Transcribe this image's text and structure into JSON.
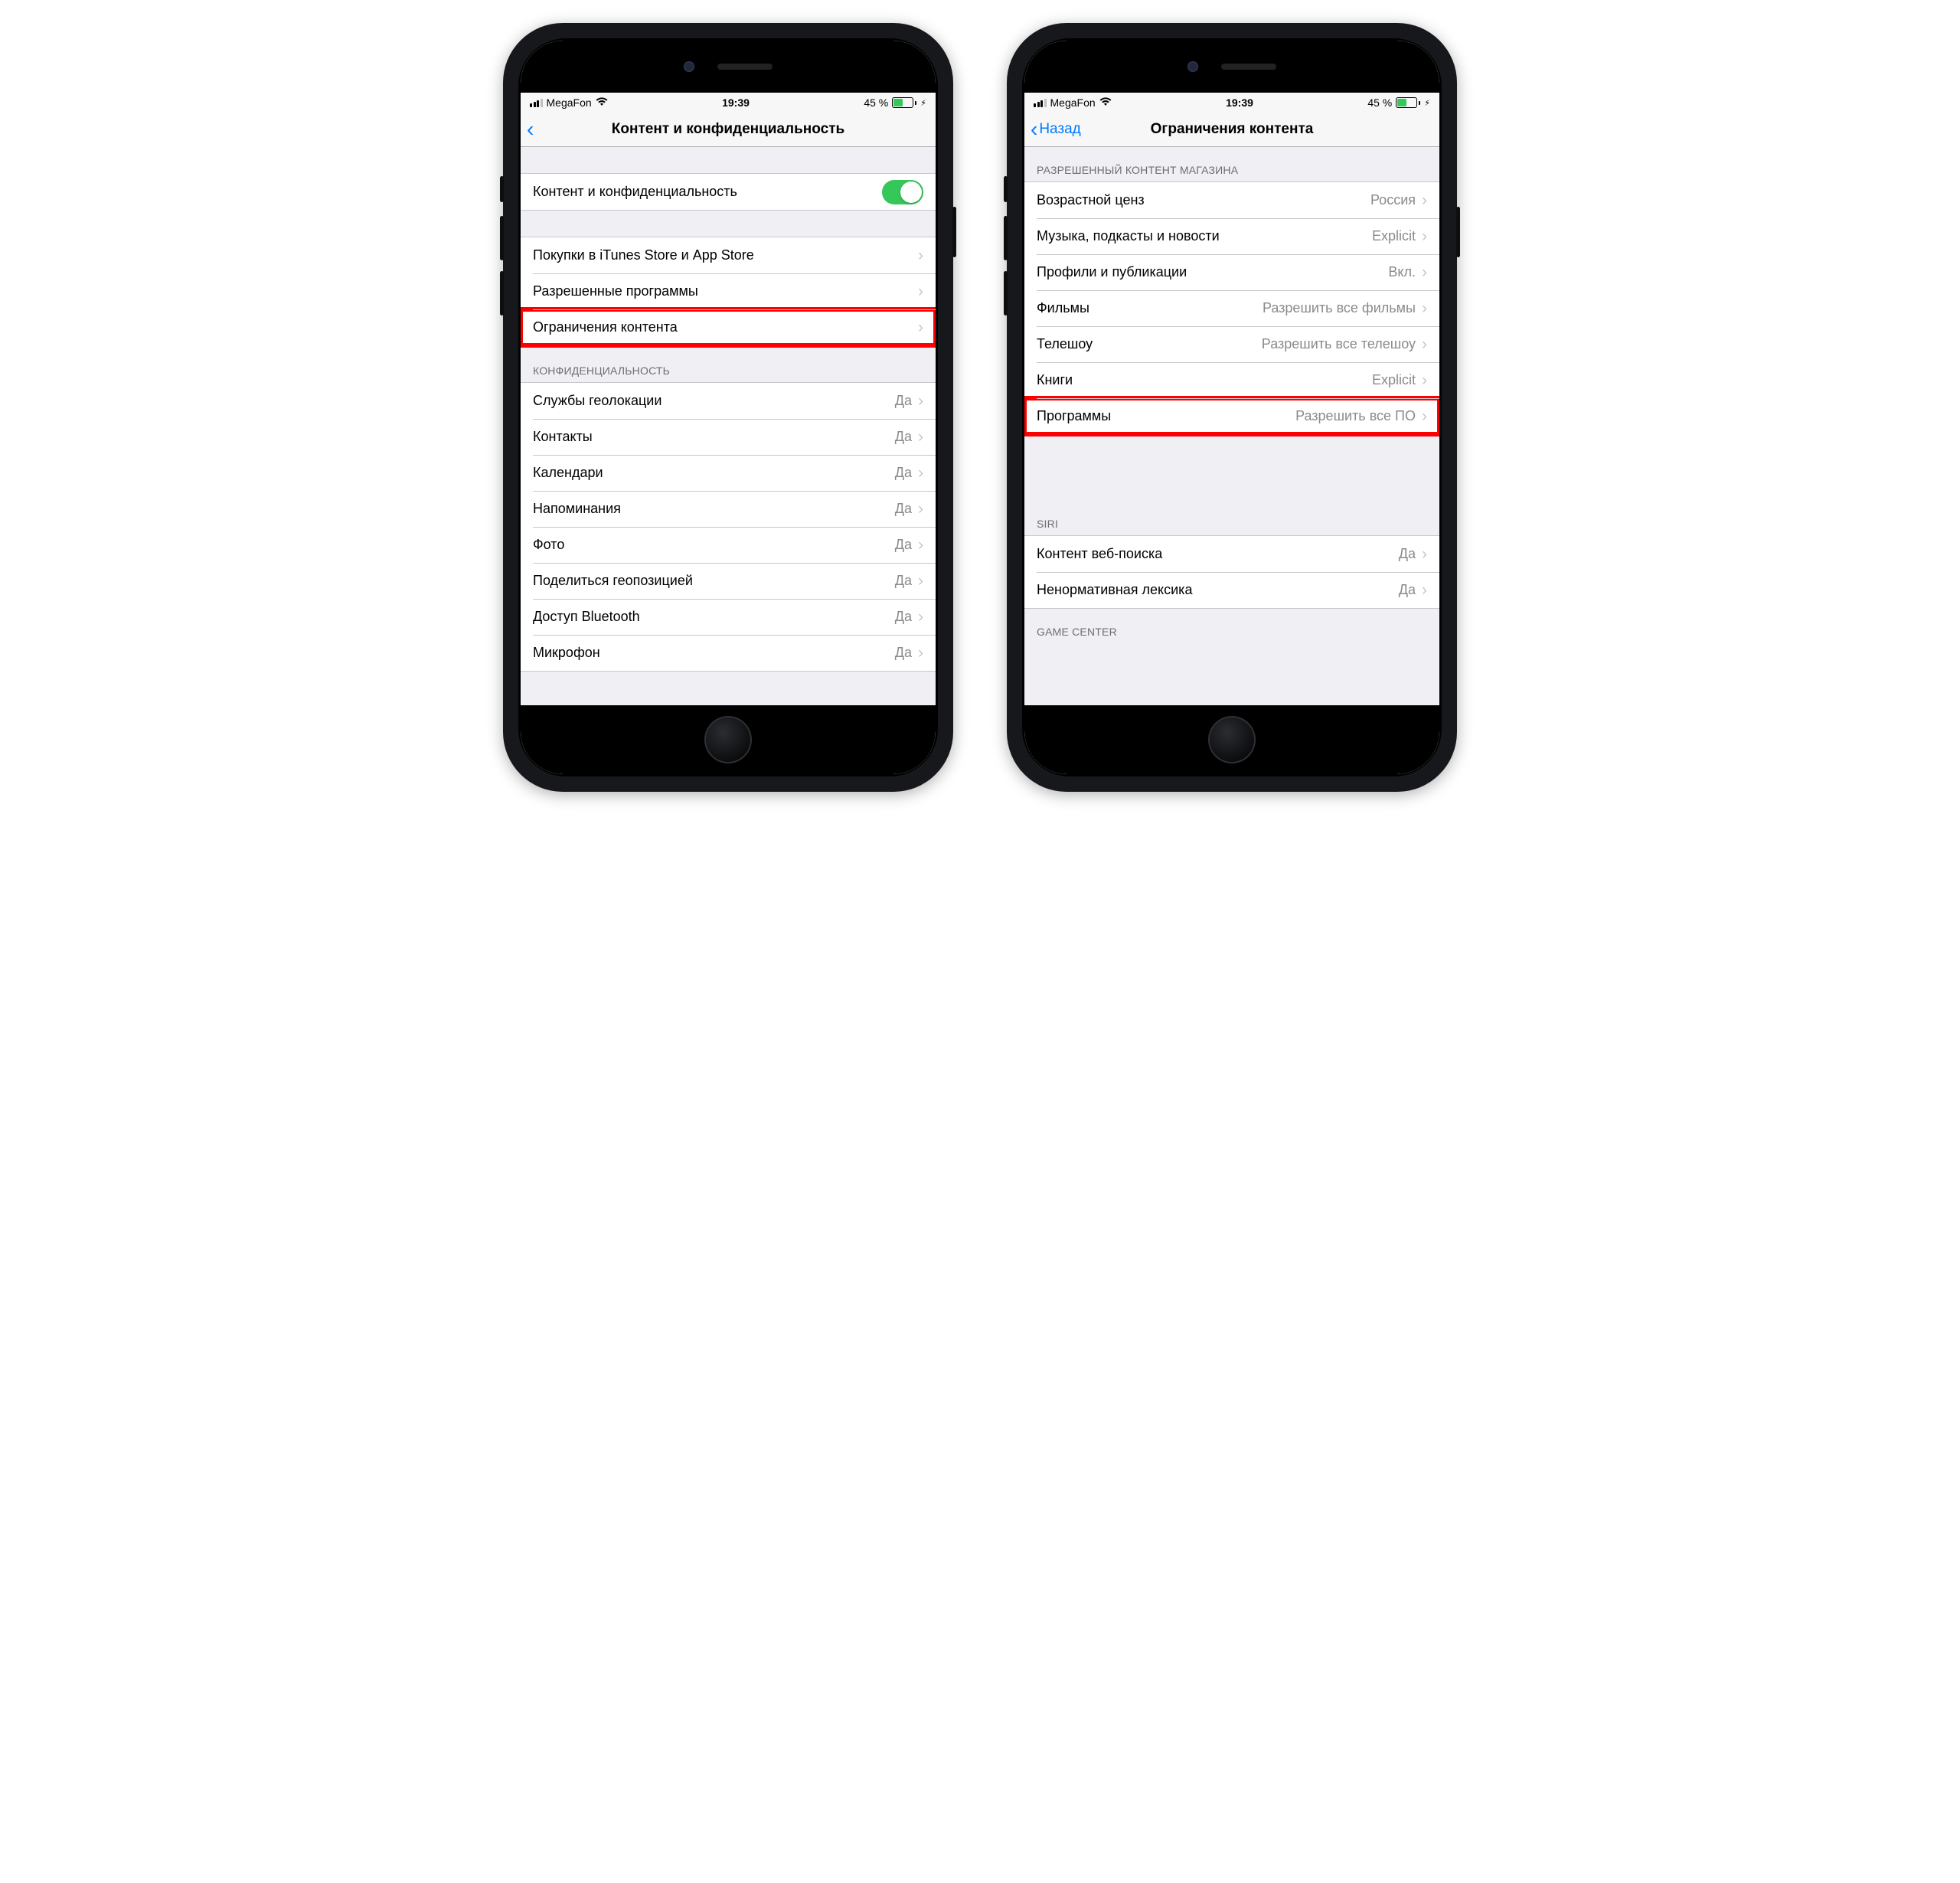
{
  "status": {
    "carrier": "MegaFon",
    "time": "19:39",
    "battery_pct": "45 %"
  },
  "left": {
    "nav_title": "Контент и конфиденциальность",
    "toggle_row": "Контент и конфиденциальность",
    "group_main": [
      {
        "label": "Покупки в iTunes Store и App Store"
      },
      {
        "label": "Разрешенные программы"
      },
      {
        "label": "Ограничения контента",
        "highlight": true
      }
    ],
    "privacy_header": "КОНФИДЕНЦИАЛЬНОСТЬ",
    "group_privacy": [
      {
        "label": "Службы геолокации",
        "value": "Да"
      },
      {
        "label": "Контакты",
        "value": "Да"
      },
      {
        "label": "Календари",
        "value": "Да"
      },
      {
        "label": "Напоминания",
        "value": "Да"
      },
      {
        "label": "Фото",
        "value": "Да"
      },
      {
        "label": "Поделиться геопозицией",
        "value": "Да"
      },
      {
        "label": "Доступ Bluetooth",
        "value": "Да"
      },
      {
        "label": "Микрофон",
        "value": "Да"
      }
    ]
  },
  "right": {
    "nav_back": "Назад",
    "nav_title": "Ограничения контента",
    "store_header": "РАЗРЕШЕННЫЙ КОНТЕНТ МАГАЗИНА",
    "group_store": [
      {
        "label": "Возрастной ценз",
        "value": "Россия"
      },
      {
        "label": "Музыка, подкасты и новости",
        "value": "Explicit"
      },
      {
        "label": "Профили и публикации",
        "value": "Вкл."
      },
      {
        "label": "Фильмы",
        "value": "Разрешить все фильмы"
      },
      {
        "label": "Телешоу",
        "value": "Разрешить все телешоу"
      },
      {
        "label": "Книги",
        "value": "Explicit"
      },
      {
        "label": "Программы",
        "value": "Разрешить все ПО",
        "highlight": true
      }
    ],
    "siri_header": "SIRI",
    "group_siri": [
      {
        "label": "Контент веб-поиска",
        "value": "Да"
      },
      {
        "label": "Ненормативная лексика",
        "value": "Да"
      }
    ],
    "gc_header": "GAME CENTER"
  }
}
